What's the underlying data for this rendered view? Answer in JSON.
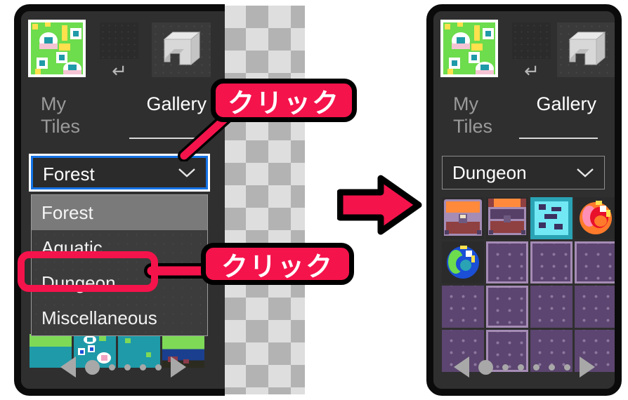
{
  "app": {
    "toolbar": {
      "thumbnail_name": "tile-preview-forest",
      "blank_tile_name": "empty-tile-slot",
      "enter_icon": "↵",
      "box_icon_name": "3d-box-icon"
    },
    "tabs": {
      "my_tiles_label": "My Tiles",
      "gallery_label": "Gallery",
      "active": "Gallery"
    }
  },
  "left_panel": {
    "select": {
      "value": "Forest",
      "expanded": true,
      "focus_color": "#1473e6"
    },
    "dropdown_options": [
      {
        "label": "Forest",
        "highlighted": true
      },
      {
        "label": "Aquatic",
        "highlighted": false
      },
      {
        "label": "Dungeon",
        "highlighted": false
      },
      {
        "label": "Miscellaneous",
        "highlighted": false
      }
    ],
    "tiles": [
      {
        "name": "water-grass-tile-1",
        "kind": "t-water-grass"
      },
      {
        "name": "water-flower-tile",
        "kind": "t-water"
      },
      {
        "name": "water-tile-plain",
        "kind": "t-water"
      },
      {
        "name": "grass-cliff-tile",
        "kind": "t-grass-cliff"
      }
    ],
    "pager": {
      "prev_label": "◀",
      "next_label": "▶",
      "page_count": 5,
      "current_page": 1
    }
  },
  "right_panel": {
    "select": {
      "value": "Dungeon",
      "expanded": false
    },
    "tiles": [
      {
        "name": "chest-closed-tile",
        "kind": "t-chest"
      },
      {
        "name": "chest-open-tile",
        "kind": "t-chest"
      },
      {
        "name": "water-swirl-tile",
        "kind": "t-dark"
      },
      {
        "name": "fire-orb-tile",
        "kind": "t-dark"
      },
      {
        "name": "earth-orb-tile",
        "kind": "t-dark"
      },
      {
        "name": "dungeon-floor-tile",
        "kind": "t-floor"
      },
      {
        "name": "dungeon-floor-tile",
        "kind": "t-floor"
      },
      {
        "name": "dungeon-floor-tile",
        "kind": "t-floor"
      },
      {
        "name": "dungeon-floor-tile",
        "kind": "t-floor plain"
      },
      {
        "name": "dungeon-floor-tile",
        "kind": "t-floor"
      },
      {
        "name": "dungeon-floor-tile",
        "kind": "t-floor plain"
      },
      {
        "name": "dungeon-floor-tile",
        "kind": "t-floor plain"
      },
      {
        "name": "dungeon-floor-tile",
        "kind": "t-floor plain"
      },
      {
        "name": "dungeon-floor-tile",
        "kind": "t-floor"
      },
      {
        "name": "dungeon-floor-tile",
        "kind": "t-floor plain"
      },
      {
        "name": "dungeon-floor-tile",
        "kind": "t-floor plain"
      }
    ],
    "pager": {
      "prev_label": "◀",
      "next_label": "▶",
      "page_count": 6,
      "current_page": 1
    }
  },
  "annotations": {
    "callout_1": "クリック",
    "callout_2": "クリック",
    "accent_color": "#f5134b",
    "outline_color": "#000000",
    "flow_arrow_name": "step-flow-arrow"
  }
}
